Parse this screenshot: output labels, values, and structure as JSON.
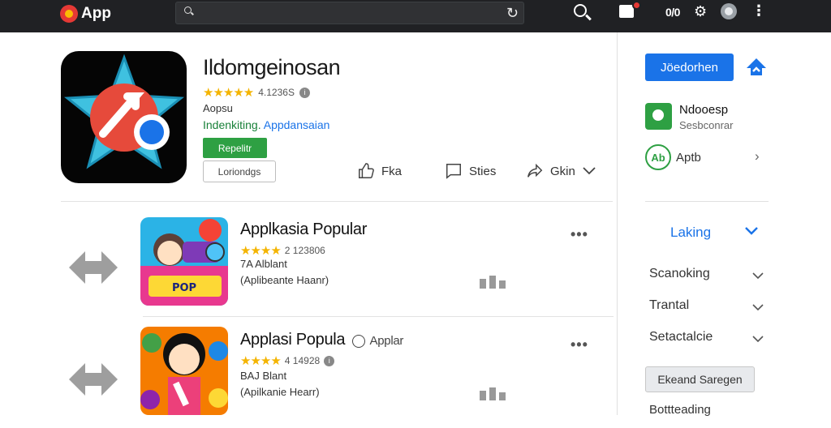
{
  "topbar": {
    "app_name": "App",
    "search_value": "",
    "count_label": "0/0",
    "icons": [
      "app-logo-icon",
      "search-icon",
      "refresh-icon",
      "notification-icon",
      "gear-icon",
      "avatar-icon",
      "more-vert-icon"
    ]
  },
  "app": {
    "title": "Ildomgeinosan",
    "stars": "★★★★★",
    "rating_text": "4.1236S",
    "developer": "Aopsu",
    "category_green": "Indenkiting.",
    "category_blue": "Appdansaian",
    "install_label": "Repelitr",
    "wishlist_label": "Loriondgs",
    "actions": [
      {
        "label": "Fka",
        "icon": "thumbs-up-icon"
      },
      {
        "label": "Sties",
        "icon": "comment-icon"
      },
      {
        "label": "Gkin",
        "icon": "share-icon"
      }
    ]
  },
  "list": [
    {
      "title": "Applkasia Popular",
      "tag": "",
      "stars": "★★★★",
      "rating_text": "2 123806",
      "line1": "7A Alblant",
      "line2": "(Aplibeante Haanr)"
    },
    {
      "title": "Applasi Popula",
      "tag": "Applar",
      "stars": "★★★★",
      "rating_text": "4 14928",
      "line1": "BAJ Blant",
      "line2": "(Apilkanie Hearr)"
    }
  ],
  "sidebar": {
    "primary_button": "Jöedorhen",
    "dev_title": "Ndooesp",
    "dev_subtitle": "Sesbconrar",
    "apk_badge": "Ab",
    "apk_label": "Aptb",
    "ranking_label": "Laking",
    "rows": [
      "Scanoking",
      "Trantal",
      "Setactalcie"
    ],
    "explore_button": "Ekeand Saregen",
    "bottom_label": "Bottteading"
  },
  "colors": {
    "topbar": "#202124",
    "accent_blue": "#1a73e8",
    "accent_green": "#2ea043",
    "star": "#f4b400"
  }
}
